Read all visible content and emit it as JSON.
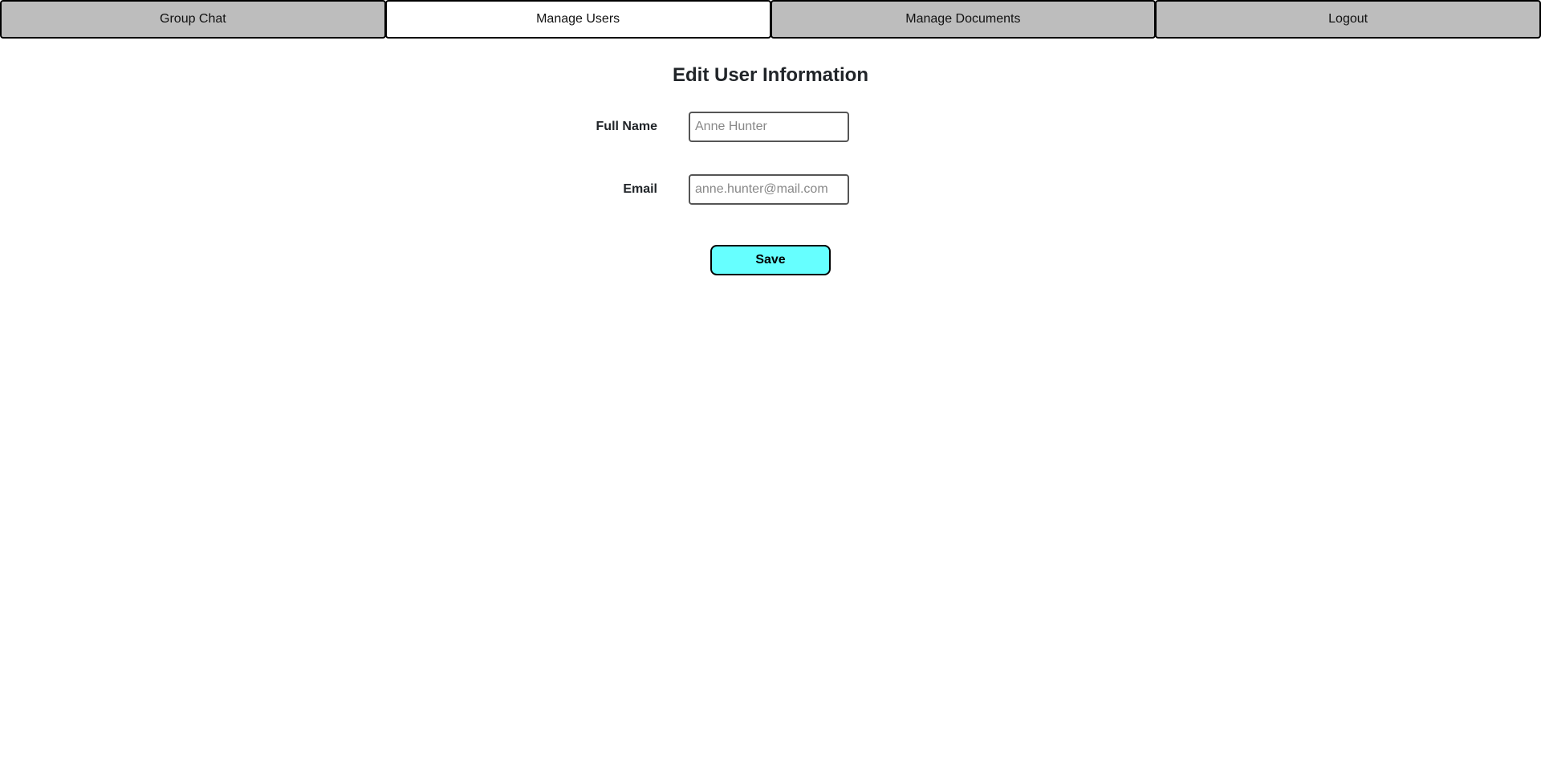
{
  "nav": {
    "tabs": [
      {
        "label": "Group Chat",
        "active": false
      },
      {
        "label": "Manage Users",
        "active": true
      },
      {
        "label": "Manage Documents",
        "active": false
      },
      {
        "label": "Logout",
        "active": false
      }
    ]
  },
  "main": {
    "title": "Edit User Information",
    "fields": {
      "full_name": {
        "label": "Full Name",
        "value": "",
        "placeholder": "Anne Hunter"
      },
      "email": {
        "label": "Email",
        "value": "",
        "placeholder": "anne.hunter@mail.com"
      }
    },
    "save_label": "Save"
  },
  "colors": {
    "tab_background": "#bdbdbd",
    "active_tab_background": "#ffffff",
    "save_button": "#66ffff"
  }
}
